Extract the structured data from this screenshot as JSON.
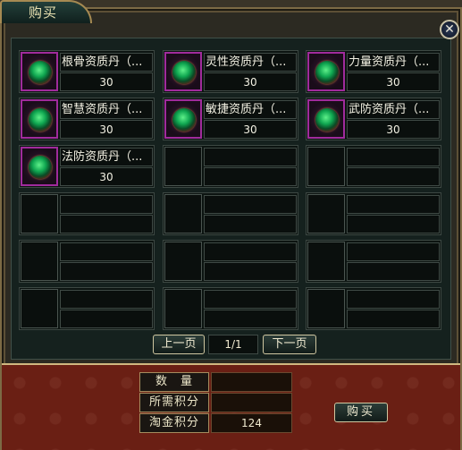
{
  "window": {
    "title": "购买",
    "close_symbol": "✕"
  },
  "items": [
    {
      "name": "根骨资质丹（...",
      "value": "30",
      "icon": "jade-orb-icon"
    },
    {
      "name": "灵性资质丹（...",
      "value": "30",
      "icon": "jade-orb-icon"
    },
    {
      "name": "力量资质丹（...",
      "value": "30",
      "icon": "jade-orb-icon"
    },
    {
      "name": "智慧资质丹（...",
      "value": "30",
      "icon": "jade-orb-icon"
    },
    {
      "name": "敏捷资质丹（...",
      "value": "30",
      "icon": "jade-orb-icon"
    },
    {
      "name": "武防资质丹（...",
      "value": "30",
      "icon": "jade-orb-icon"
    },
    {
      "name": "法防资质丹（...",
      "value": "30",
      "icon": "jade-orb-icon"
    }
  ],
  "pager": {
    "prev_label": "上一页",
    "page": "1/1",
    "next_label": "下一页"
  },
  "form": {
    "quantity_label": "数　量",
    "quantity_value": "",
    "required_points_label": "所需积分",
    "required_points_value": "",
    "gold_points_label": "淘金积分",
    "gold_points_value": "124"
  },
  "buy_label": "购买",
  "colors": {
    "panel_bg": "#15211e",
    "bottom_bg": "#6a1f14",
    "icon_border": "#a02b9c"
  }
}
